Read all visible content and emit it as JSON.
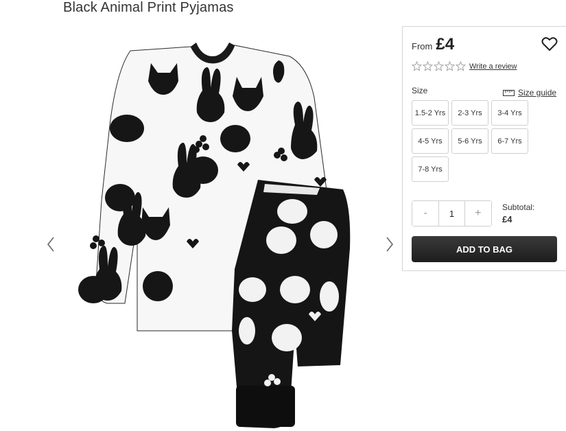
{
  "product": {
    "title": "Black Animal Print Pyjamas"
  },
  "gallery": {
    "prev_icon": "chevron-left-icon",
    "next_icon": "chevron-right-icon"
  },
  "purchase": {
    "from_label": "From",
    "price": "£4",
    "wishlist_icon": "heart-outline-icon",
    "rating_stars": 5,
    "rating_value": 0,
    "review_link": "Write a review",
    "size_label": "Size",
    "size_guide": "Size guide",
    "sizes": [
      "1.5-2 Yrs",
      "2-3 Yrs",
      "3-4 Yrs",
      "4-5 Yrs",
      "5-6 Yrs",
      "6-7 Yrs",
      "7-8 Yrs"
    ],
    "quantity": {
      "minus": "-",
      "value": "1",
      "plus": "+"
    },
    "subtotal_label": "Subtotal:",
    "subtotal_value": "£4",
    "add_to_bag": "ADD TO BAG"
  },
  "colors": {
    "button_bg": "#1d1d1d",
    "border": "#cfcfcf",
    "text": "#333333"
  }
}
